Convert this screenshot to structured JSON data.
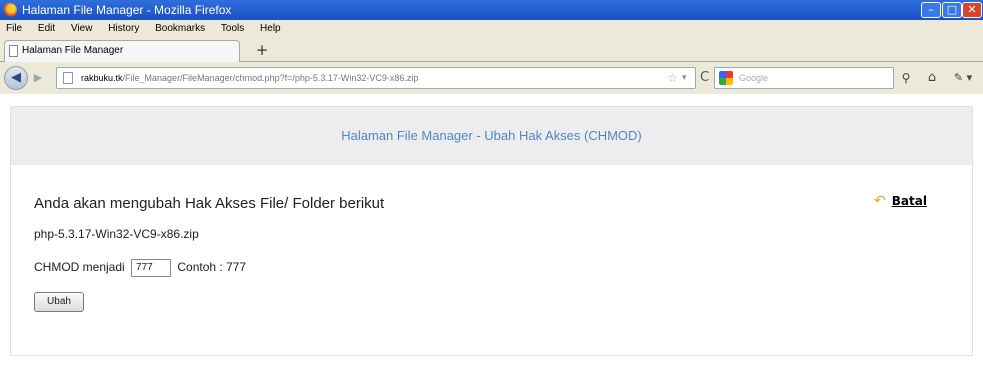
{
  "window": {
    "title": "Halaman File Manager - Mozilla Firefox",
    "minimize_glyph": "–",
    "maximize_glyph": "□",
    "close_glyph": "✕"
  },
  "menubar": {
    "items": [
      "File",
      "Edit",
      "View",
      "History",
      "Bookmarks",
      "Tools",
      "Help"
    ]
  },
  "tabs": {
    "active_label": "Halaman File Manager",
    "new_tab_glyph": "+"
  },
  "navbar": {
    "url_domain": "rakbuku.tk",
    "url_path": "/File_Manager/FileManager/chmod.php?f=/php-5.3.17-Win32-VC9-x86.zip",
    "search_placeholder": "Google",
    "back_glyph": "◀",
    "forward_glyph": "▶",
    "reload_glyph": "C",
    "star_glyph": "☆",
    "dropdown_glyph": "▾",
    "search_glyph": "⚲",
    "home_glyph": "⌂",
    "ext_glyph": "✎ ▾"
  },
  "page": {
    "header_title": "Halaman File Manager - Ubah Hak Akses (CHMOD)",
    "heading": "Anda akan mengubah Hak Akses File/ Folder berikut",
    "filename": "php-5.3.17-Win32-VC9-x86.zip",
    "chmod_label": "CHMOD menjadi",
    "chmod_value": "777",
    "chmod_hint": "Contoh : 777",
    "submit_label": "Ubah",
    "cancel_label": "Batal",
    "cancel_icon": "undo-arrow"
  },
  "colors": {
    "title_bar": "#1b4fbf",
    "header_text": "#4e87c7",
    "header_bg": "#ededed",
    "chrome_bg": "#ece9d8"
  }
}
